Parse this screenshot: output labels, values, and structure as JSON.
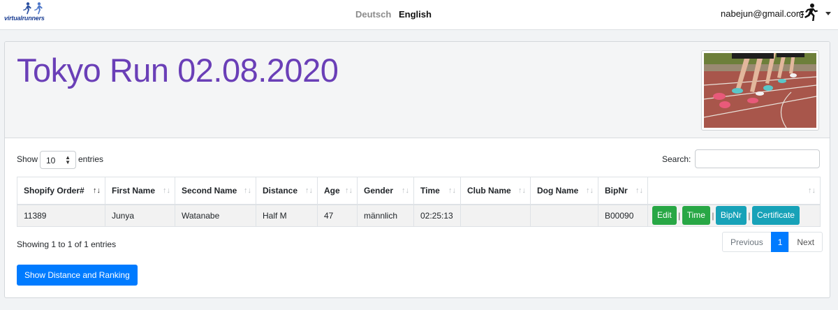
{
  "navbar": {
    "logo_text": "virtualrunners",
    "languages": [
      "Deutsch",
      "English"
    ],
    "active_language": "English",
    "user_email": "nabejun@gmail.com"
  },
  "event": {
    "title": "Tokyo Run 02.08.2020"
  },
  "table_controls": {
    "show_label": "Show",
    "page_length": "10",
    "entries_label": "entries",
    "search_label": "Search:",
    "search_value": ""
  },
  "table": {
    "columns": [
      "Shopify Order#",
      "First Name",
      "Second Name",
      "Distance",
      "Age",
      "Gender",
      "Time",
      "Club Name",
      "Dog Name",
      "BipNr",
      ""
    ],
    "sorted_column": "Shopify Order#",
    "rows": [
      {
        "order": "11389",
        "first_name": "Junya",
        "second_name": "Watanabe",
        "distance": "Half M",
        "age": "47",
        "gender": "männlich",
        "time": "02:25:13",
        "club_name": "",
        "dog_name": "",
        "bipnr": "B00090",
        "actions": [
          "Edit",
          "Time",
          "BipNr",
          "Certificate"
        ]
      }
    ]
  },
  "footer": {
    "info": "Showing 1 to 1 of 1 entries",
    "pagination": {
      "previous": "Previous",
      "current": "1",
      "next": "Next"
    },
    "primary_button": "Show Distance and Ranking"
  },
  "colors": {
    "title": "#6a3fb7",
    "primary": "#007bff",
    "success": "#28a745",
    "info": "#17a2b8"
  }
}
